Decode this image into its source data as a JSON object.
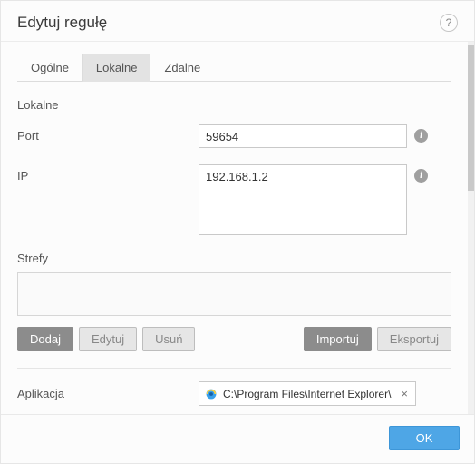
{
  "dialog": {
    "title": "Edytuj regułę"
  },
  "tabs": [
    {
      "label": "Ogólne",
      "active": false
    },
    {
      "label": "Lokalne",
      "active": true
    },
    {
      "label": "Zdalne",
      "active": false
    }
  ],
  "local": {
    "section_header": "Lokalne",
    "port_label": "Port",
    "port_value": "59654",
    "ip_label": "IP",
    "ip_value": "192.168.1.2",
    "zones_label": "Strefy"
  },
  "buttons": {
    "add": "Dodaj",
    "edit": "Edytuj",
    "delete": "Usuń",
    "import": "Importuj",
    "export": "Eksportuj"
  },
  "application": {
    "label": "Aplikacja",
    "path": "C:\\Program Files\\Internet Explorer\\"
  },
  "footer": {
    "ok": "OK"
  }
}
